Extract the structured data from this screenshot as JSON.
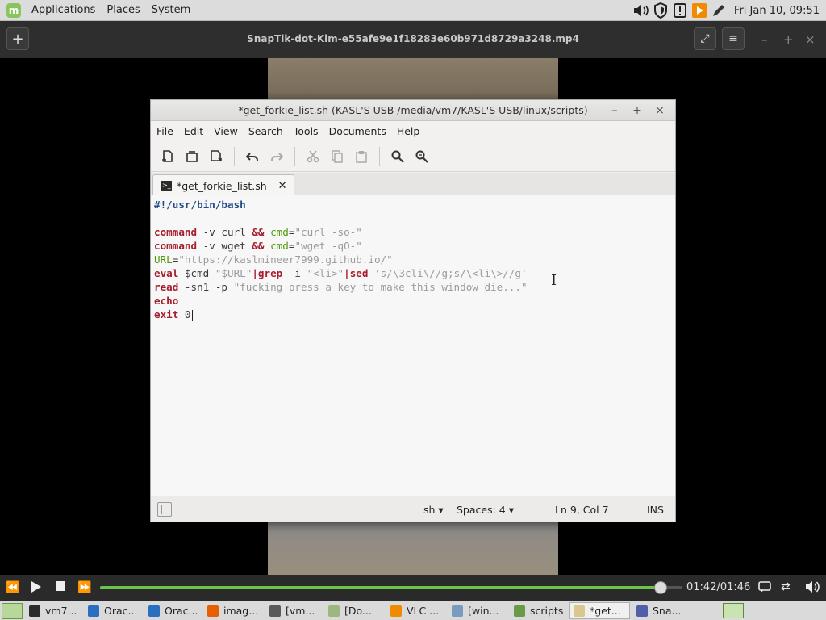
{
  "top_panel": {
    "menus": [
      "Applications",
      "Places",
      "System"
    ],
    "clock": "Fri Jan 10, 09:51",
    "tray_icons": [
      "volume-icon",
      "shield-icon",
      "update-icon",
      "vlc-icon",
      "pen-icon"
    ]
  },
  "player": {
    "title": "SnapTik-dot-Kim-e55afe9e1f18283e60b971d8729a3248.mp4",
    "time_display": "01:42/01:46",
    "progress_fraction": 0.962
  },
  "editor": {
    "window_title": "*get_forkie_list.sh (KASL'S USB /media/vm7/KASL'S USB/linux/scripts)",
    "menus": [
      "File",
      "Edit",
      "View",
      "Search",
      "Tools",
      "Documents",
      "Help"
    ],
    "tab_label": "*get_forkie_list.sh",
    "code": [
      [
        {
          "t": "#!/usr/bin/bash",
          "c": "sh"
        }
      ],
      [],
      [
        {
          "t": "command",
          "c": "kw"
        },
        {
          "t": " -v curl ",
          "c": ""
        },
        {
          "t": "&&",
          "c": "kw"
        },
        {
          "t": " ",
          "c": ""
        },
        {
          "t": "cmd",
          "c": "var"
        },
        {
          "t": "=",
          "c": ""
        },
        {
          "t": "\"curl -so-\"",
          "c": "str"
        }
      ],
      [
        {
          "t": "command",
          "c": "kw"
        },
        {
          "t": " -v wget ",
          "c": ""
        },
        {
          "t": "&&",
          "c": "kw"
        },
        {
          "t": " ",
          "c": ""
        },
        {
          "t": "cmd",
          "c": "var"
        },
        {
          "t": "=",
          "c": ""
        },
        {
          "t": "\"wget -qO-\"",
          "c": "str"
        }
      ],
      [
        {
          "t": "URL",
          "c": "var"
        },
        {
          "t": "=",
          "c": ""
        },
        {
          "t": "\"https://kaslmineer7999.github.io/\"",
          "c": "str"
        }
      ],
      [
        {
          "t": "eval",
          "c": "kw"
        },
        {
          "t": " $cmd ",
          "c": ""
        },
        {
          "t": "\"$URL\"",
          "c": "str"
        },
        {
          "t": "|grep",
          "c": "kw"
        },
        {
          "t": " -i ",
          "c": ""
        },
        {
          "t": "\"<li>\"",
          "c": "str"
        },
        {
          "t": "|sed",
          "c": "kw"
        },
        {
          "t": " ",
          "c": ""
        },
        {
          "t": "'s/\\3cli\\//g;s/\\<li\\>//g'",
          "c": "str"
        }
      ],
      [
        {
          "t": "read",
          "c": "kw"
        },
        {
          "t": " -sn1 -p ",
          "c": ""
        },
        {
          "t": "\"fucking press a key to make this window die...\"",
          "c": "str"
        }
      ],
      [
        {
          "t": "echo",
          "c": "kw"
        }
      ],
      [
        {
          "t": "exit",
          "c": "kw"
        },
        {
          "t": " 0",
          "c": ""
        }
      ]
    ],
    "status": {
      "language": "sh",
      "spaces": "Spaces: 4",
      "position": "Ln 9, Col 7",
      "mode": "INS"
    }
  },
  "taskbar": {
    "tasks": [
      {
        "label": "vm7...",
        "icon": "terminal-icon",
        "color": "#2b2b2b"
      },
      {
        "label": "Orac...",
        "icon": "virtualbox-icon",
        "color": "#2a6fc0"
      },
      {
        "label": "Orac...",
        "icon": "virtualbox-icon",
        "color": "#2a6fc0"
      },
      {
        "label": "imag...",
        "icon": "firefox-icon",
        "color": "#e66000"
      },
      {
        "label": "[vm...",
        "icon": "terminal-icon",
        "color": "#5a5a5a"
      },
      {
        "label": "[Do...",
        "icon": "folder-icon",
        "color": "#9cb87e"
      },
      {
        "label": "VLC ...",
        "icon": "vlc-icon",
        "color": "#f08a00"
      },
      {
        "label": "[win...",
        "icon": "puzzle-icon",
        "color": "#7a9bc0"
      },
      {
        "label": "scripts",
        "icon": "folder-icon",
        "color": "#6a9a48"
      },
      {
        "label": "*get...",
        "icon": "text-editor-icon",
        "color": "#d8c890",
        "active": true
      },
      {
        "label": "Sna...",
        "icon": "video-icon",
        "color": "#5060a8"
      }
    ]
  }
}
